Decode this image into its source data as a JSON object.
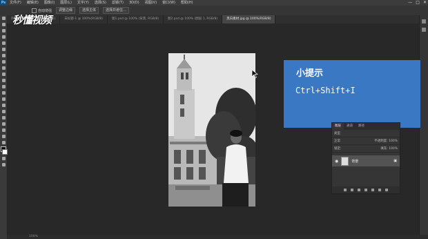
{
  "menu": {
    "logo": "Ps",
    "items": [
      "文件(F)",
      "编辑(E)",
      "图像(I)",
      "图层(L)",
      "文字(Y)",
      "选择(S)",
      "滤镜(T)",
      "3D(D)",
      "视图(V)",
      "窗口(W)",
      "帮助(H)"
    ]
  },
  "window_controls": [
    "—",
    "□",
    "✕"
  ],
  "options": {
    "auto_enhance": "自动增强",
    "refine": "调整边缘",
    "select_subject": "选择主体",
    "select_mask": "选择并遮住..."
  },
  "tabs": [
    {
      "label": "风景图片.jpg @ 100%(RGB/8)",
      "active": false
    },
    {
      "label": "未标题-1 @ 100%(RGB/8)",
      "active": false
    },
    {
      "label": "图1.psd @ 100% (背景, RGB/8)",
      "active": false
    },
    {
      "label": "图2.psd @ 100% (图层 1, RGB/8)",
      "active": false
    },
    {
      "label": "黑白素材.jpg @ 100%(RGB/8)",
      "active": true
    }
  ],
  "brand": "秒懂视频",
  "tip": {
    "title": "小提示",
    "shortcut": "Ctrl+Shift+I"
  },
  "layers_panel": {
    "tabs": [
      "图层",
      "通道",
      "路径"
    ],
    "kind_label": "类型",
    "mode": "正常",
    "opacity_label": "不透明度: 100%",
    "lock_label": "锁定:",
    "fill_label": "填充: 100%",
    "layer_name": "背景"
  },
  "status": {
    "zoom": "100%"
  }
}
